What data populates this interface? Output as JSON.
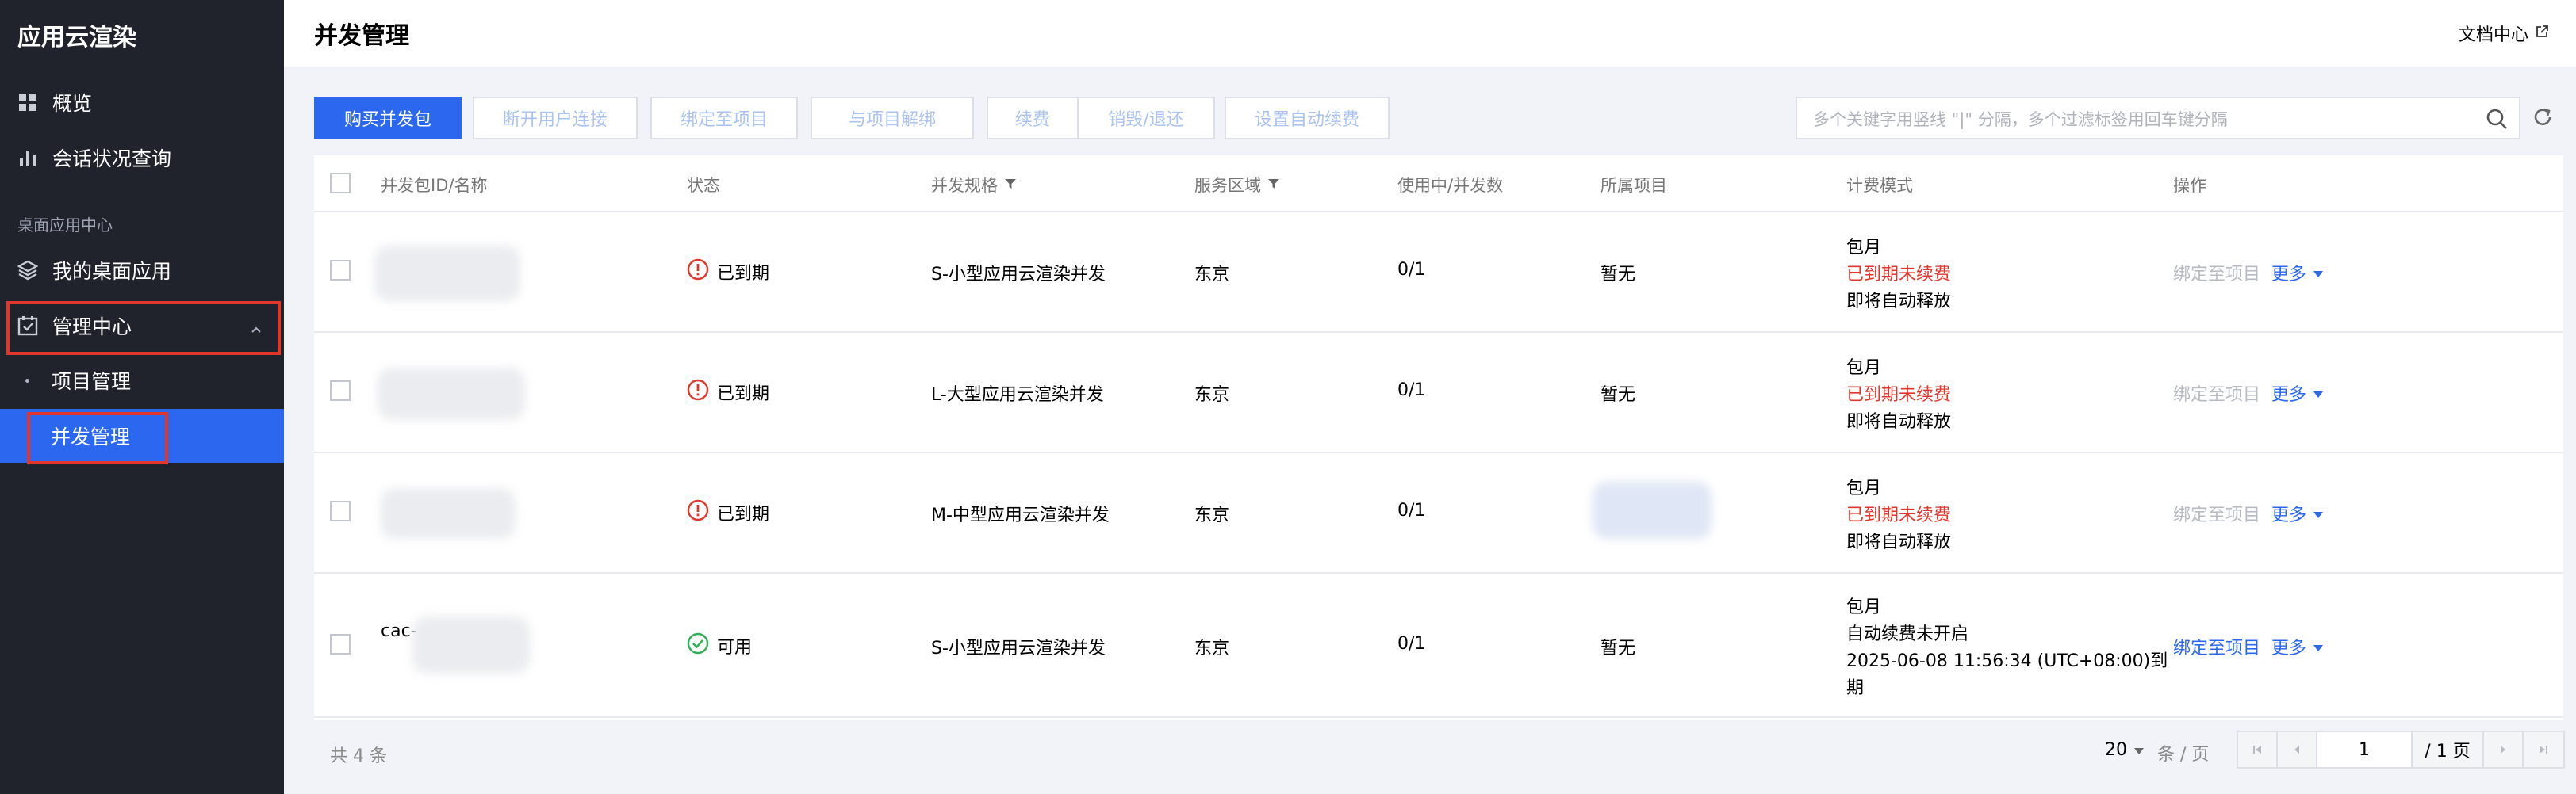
{
  "sidebar": {
    "brand": "应用云渲染",
    "items": [
      {
        "label": "概览",
        "icon": "dashboard-grid-icon"
      },
      {
        "label": "会话状况查询",
        "icon": "bar-chart-icon"
      }
    ],
    "group_label": "桌面应用中心",
    "my_apps": {
      "label": "我的桌面应用",
      "icon": "layers-icon"
    },
    "management": {
      "label": "管理中心",
      "icon": "checklist-icon",
      "expanded": true
    },
    "sub_items": [
      {
        "label": "项目管理",
        "active": false
      },
      {
        "label": "并发管理",
        "active": true
      }
    ],
    "colors": {
      "bg": "#20232c",
      "active": "#2b68ef",
      "highlight": "#e0362c"
    }
  },
  "header": {
    "title": "并发管理",
    "doc_link": "文档中心"
  },
  "toolbar": {
    "buttons": [
      "购买并发包",
      "断开用户连接",
      "绑定至项目",
      "与项目解绑",
      "续费",
      "销毁/退还",
      "设置自动续费"
    ],
    "search_placeholder": "多个关键字用竖线 \"|\" 分隔，多个过滤标签用回车键分隔"
  },
  "table": {
    "columns": [
      "并发包ID/名称",
      "状态",
      "并发规格",
      "服务区域",
      "使用中/并发数",
      "所属项目",
      "计费模式",
      "操作"
    ],
    "filterable_columns": [
      "并发规格",
      "服务区域"
    ],
    "rows": [
      {
        "status": "已到期",
        "status_type": "expired",
        "spec": "S-小型应用云渲染并发",
        "region": "东京",
        "usage": "0/1",
        "project": "暂无",
        "billing": [
          "包月",
          "已到期未续费",
          "即将自动释放"
        ],
        "bind": "绑定至项目",
        "bind_enabled": false,
        "more": "更多"
      },
      {
        "status": "已到期",
        "status_type": "expired",
        "spec": "L-大型应用云渲染并发",
        "region": "东京",
        "usage": "0/1",
        "project": "暂无",
        "billing": [
          "包月",
          "已到期未续费",
          "即将自动释放"
        ],
        "bind": "绑定至项目",
        "bind_enabled": false,
        "more": "更多"
      },
      {
        "status": "已到期",
        "status_type": "expired",
        "spec": "M-中型应用云渲染并发",
        "region": "东京",
        "usage": "0/1",
        "project": "",
        "billing": [
          "包月",
          "已到期未续费",
          "即将自动释放"
        ],
        "bind": "绑定至项目",
        "bind_enabled": false,
        "more": "更多"
      },
      {
        "id_prefix": "cac-",
        "status": "可用",
        "status_type": "available",
        "spec": "S-小型应用云渲染并发",
        "region": "东京",
        "usage": "0/1",
        "project": "暂无",
        "billing": [
          "包月",
          "自动续费未开启",
          "2025-06-08 11:56:34 (UTC+08:00)到",
          "期"
        ],
        "bind": "绑定至项目",
        "bind_enabled": true,
        "more": "更多"
      }
    ]
  },
  "footer": {
    "total": "共 4 条",
    "page_size": "20",
    "per_page_label": "条 / 页",
    "current_page": "1",
    "total_pages": "/ 1 页"
  },
  "colors": {
    "primary": "#2b68ef",
    "danger": "#e0362c",
    "success": "#2fb054"
  }
}
